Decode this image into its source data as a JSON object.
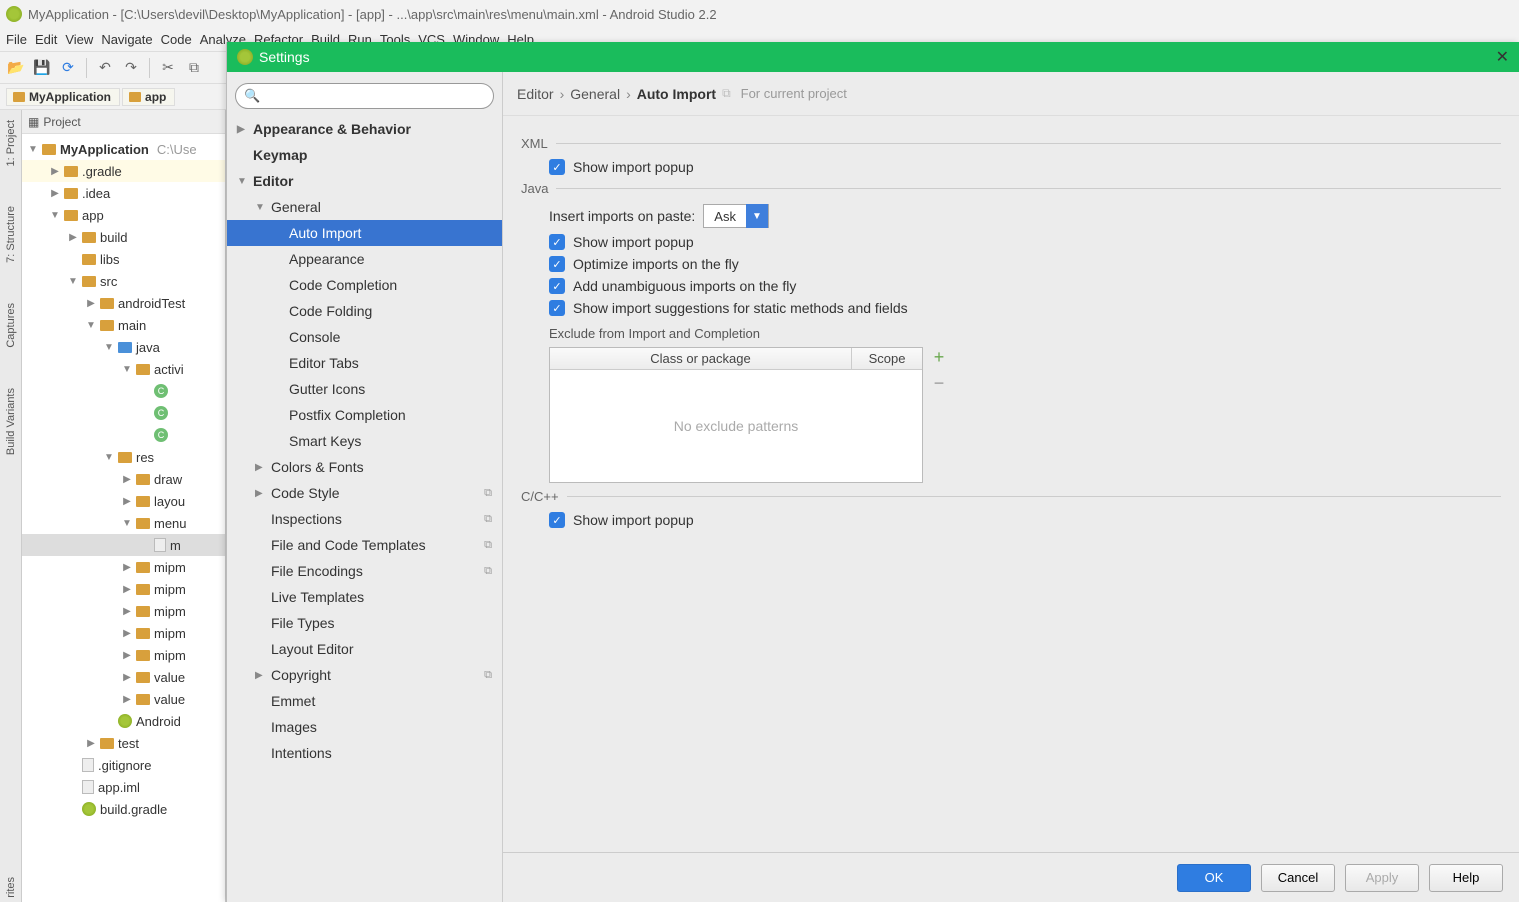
{
  "window": {
    "title": "MyApplication - [C:\\Users\\devil\\Desktop\\MyApplication] - [app] - ...\\app\\src\\main\\res\\menu\\main.xml - Android Studio 2.2"
  },
  "menu": {
    "items": [
      "File",
      "Edit",
      "View",
      "Navigate",
      "Code",
      "Analyze",
      "Refactor",
      "Build",
      "Run",
      "Tools",
      "VCS",
      "Window",
      "Help"
    ]
  },
  "breadcrumb": {
    "items": [
      "MyApplication",
      "app"
    ]
  },
  "project_pane": {
    "header": "Project",
    "root": "MyApplication",
    "root_path": "C:\\Use",
    "nodes": [
      {
        "label": ".gradle",
        "depth": 1,
        "arrow": "▶",
        "icon": "folder",
        "sel": true
      },
      {
        "label": ".idea",
        "depth": 1,
        "arrow": "▶",
        "icon": "folder"
      },
      {
        "label": "app",
        "depth": 1,
        "arrow": "▼",
        "icon": "folder"
      },
      {
        "label": "build",
        "depth": 2,
        "arrow": "▶",
        "icon": "folder"
      },
      {
        "label": "libs",
        "depth": 2,
        "arrow": "",
        "icon": "folder"
      },
      {
        "label": "src",
        "depth": 2,
        "arrow": "▼",
        "icon": "folder"
      },
      {
        "label": "androidTest",
        "depth": 3,
        "arrow": "▶",
        "icon": "folder"
      },
      {
        "label": "main",
        "depth": 3,
        "arrow": "▼",
        "icon": "folder"
      },
      {
        "label": "java",
        "depth": 4,
        "arrow": "▼",
        "icon": "folder-blue"
      },
      {
        "label": "activi",
        "depth": 5,
        "arrow": "▼",
        "icon": "pkg"
      },
      {
        "label": "",
        "depth": 6,
        "arrow": "",
        "icon": "c"
      },
      {
        "label": "",
        "depth": 6,
        "arrow": "",
        "icon": "c"
      },
      {
        "label": "",
        "depth": 6,
        "arrow": "",
        "icon": "c"
      },
      {
        "label": "res",
        "depth": 4,
        "arrow": "▼",
        "icon": "pkg"
      },
      {
        "label": "draw",
        "depth": 5,
        "arrow": "▶",
        "icon": "pkg"
      },
      {
        "label": "layou",
        "depth": 5,
        "arrow": "▶",
        "icon": "pkg"
      },
      {
        "label": "menu",
        "depth": 5,
        "arrow": "▼",
        "icon": "pkg"
      },
      {
        "label": "m",
        "depth": 6,
        "arrow": "",
        "icon": "file",
        "sel2": true
      },
      {
        "label": "mipm",
        "depth": 5,
        "arrow": "▶",
        "icon": "pkg"
      },
      {
        "label": "mipm",
        "depth": 5,
        "arrow": "▶",
        "icon": "pkg"
      },
      {
        "label": "mipm",
        "depth": 5,
        "arrow": "▶",
        "icon": "pkg"
      },
      {
        "label": "mipm",
        "depth": 5,
        "arrow": "▶",
        "icon": "pkg"
      },
      {
        "label": "mipm",
        "depth": 5,
        "arrow": "▶",
        "icon": "pkg"
      },
      {
        "label": "value",
        "depth": 5,
        "arrow": "▶",
        "icon": "pkg"
      },
      {
        "label": "value",
        "depth": 5,
        "arrow": "▶",
        "icon": "pkg"
      },
      {
        "label": "Android",
        "depth": 4,
        "arrow": "",
        "icon": "alogo"
      },
      {
        "label": "test",
        "depth": 3,
        "arrow": "▶",
        "icon": "folder"
      },
      {
        "label": ".gitignore",
        "depth": 2,
        "arrow": "",
        "icon": "file"
      },
      {
        "label": "app.iml",
        "depth": 2,
        "arrow": "",
        "icon": "file"
      },
      {
        "label": "build.gradle",
        "depth": 2,
        "arrow": "",
        "icon": "alogo"
      }
    ]
  },
  "side_tabs": [
    "1: Project",
    "7: Structure",
    "Captures",
    "Build Variants"
  ],
  "side_tabs_bottom": "rites",
  "dialog": {
    "title": "Settings",
    "search_placeholder": "",
    "tree": [
      {
        "label": "Appearance & Behavior",
        "depth": 0,
        "arrow": "▶",
        "bold": true
      },
      {
        "label": "Keymap",
        "depth": 0,
        "arrow": "",
        "bold": true
      },
      {
        "label": "Editor",
        "depth": 0,
        "arrow": "▼",
        "bold": true
      },
      {
        "label": "General",
        "depth": 1,
        "arrow": "▼"
      },
      {
        "label": "Auto Import",
        "depth": 2,
        "arrow": "",
        "selected": true
      },
      {
        "label": "Appearance",
        "depth": 2,
        "arrow": ""
      },
      {
        "label": "Code Completion",
        "depth": 2,
        "arrow": ""
      },
      {
        "label": "Code Folding",
        "depth": 2,
        "arrow": ""
      },
      {
        "label": "Console",
        "depth": 2,
        "arrow": ""
      },
      {
        "label": "Editor Tabs",
        "depth": 2,
        "arrow": ""
      },
      {
        "label": "Gutter Icons",
        "depth": 2,
        "arrow": ""
      },
      {
        "label": "Postfix Completion",
        "depth": 2,
        "arrow": ""
      },
      {
        "label": "Smart Keys",
        "depth": 2,
        "arrow": ""
      },
      {
        "label": "Colors & Fonts",
        "depth": 1,
        "arrow": "▶"
      },
      {
        "label": "Code Style",
        "depth": 1,
        "arrow": "▶",
        "copy": true
      },
      {
        "label": "Inspections",
        "depth": 1,
        "arrow": "",
        "copy": true
      },
      {
        "label": "File and Code Templates",
        "depth": 1,
        "arrow": "",
        "copy": true
      },
      {
        "label": "File Encodings",
        "depth": 1,
        "arrow": "",
        "copy": true
      },
      {
        "label": "Live Templates",
        "depth": 1,
        "arrow": ""
      },
      {
        "label": "File Types",
        "depth": 1,
        "arrow": ""
      },
      {
        "label": "Layout Editor",
        "depth": 1,
        "arrow": ""
      },
      {
        "label": "Copyright",
        "depth": 1,
        "arrow": "▶",
        "copy": true
      },
      {
        "label": "Emmet",
        "depth": 1,
        "arrow": ""
      },
      {
        "label": "Images",
        "depth": 1,
        "arrow": ""
      },
      {
        "label": "Intentions",
        "depth": 1,
        "arrow": ""
      }
    ],
    "crumb": {
      "editor": "Editor",
      "general": "General",
      "auto_import": "Auto Import",
      "project": "For current project"
    },
    "sections": {
      "xml": {
        "label": "XML",
        "show_popup": "Show import popup"
      },
      "java": {
        "label": "Java",
        "insert_label": "Insert imports on paste:",
        "insert_value": "Ask",
        "show_popup": "Show import popup",
        "optimize": "Optimize imports on the fly",
        "unambiguous": "Add unambiguous imports on the fly",
        "static": "Show import suggestions for static methods and fields",
        "exclude_label": "Exclude from Import and Completion",
        "col_class": "Class or package",
        "col_scope": "Scope",
        "empty": "No exclude patterns"
      },
      "cpp": {
        "label": "C/C++",
        "show_popup": "Show import popup"
      }
    },
    "footer": {
      "ok": "OK",
      "cancel": "Cancel",
      "apply": "Apply",
      "help": "Help"
    }
  }
}
